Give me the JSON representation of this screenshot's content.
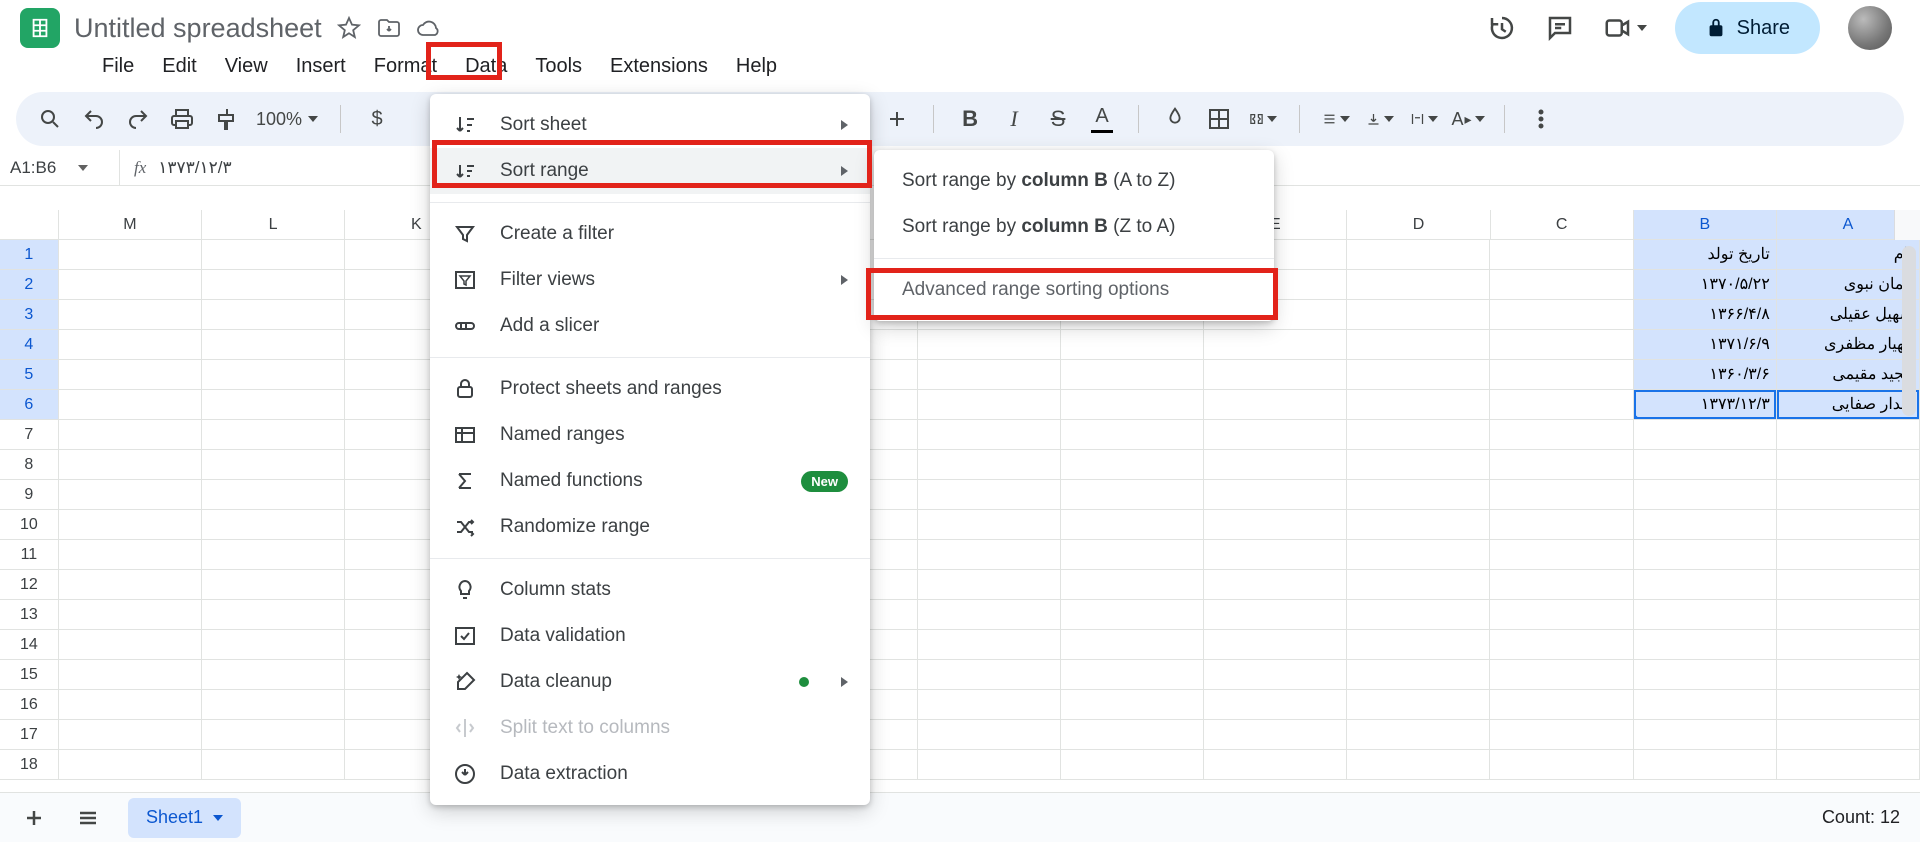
{
  "doc": {
    "title": "Untitled spreadsheet"
  },
  "menus": [
    "File",
    "Edit",
    "View",
    "Insert",
    "Format",
    "Data",
    "Tools",
    "Extensions",
    "Help"
  ],
  "share": "Share",
  "toolbar": {
    "zoom": "100%",
    "currency": "$"
  },
  "namebox": "A1:B6",
  "fx_value": "۱۳۷۳/۱۲/۳",
  "columns_visible": [
    "M",
    "L",
    "K",
    "",
    "",
    "",
    "",
    "",
    "E",
    "D",
    "C",
    "B",
    "A"
  ],
  "col_sel": [
    11,
    12
  ],
  "rows": 18,
  "row_sel": [
    1,
    2,
    3,
    4,
    5,
    6
  ],
  "cells": {
    "B": [
      "تاريخ تولد",
      "١٣٧٠/۵/٢٢",
      "١٣۶۶/۴/٨",
      "١٣٧١/۶/٩",
      "١٣۶٠/٣/۶",
      "١٣٧٣/١٢/٣"
    ],
    "A": [
      "نام",
      "ايمان نبوی",
      "سهيل عقيلی",
      "مهيار مظفری",
      "مجيد مقيمی",
      "بهدار صفايی"
    ]
  },
  "data_menu": {
    "sort_sheet": "Sort sheet",
    "sort_range": "Sort range",
    "create_filter": "Create a filter",
    "filter_views": "Filter views",
    "add_slicer": "Add a slicer",
    "protect": "Protect sheets and ranges",
    "named_ranges": "Named ranges",
    "named_functions": "Named functions",
    "named_functions_badge": "New",
    "randomize": "Randomize range",
    "column_stats": "Column stats",
    "data_validation": "Data validation",
    "data_cleanup": "Data cleanup",
    "split": "Split text to columns",
    "extraction": "Data extraction"
  },
  "sort_submenu": {
    "asc_pre": "Sort range by ",
    "asc_col": "column B",
    "asc_suf": " (A to Z)",
    "desc_pre": "Sort range by ",
    "desc_col": "column B",
    "desc_suf": " (Z to A)",
    "advanced": "Advanced range sorting options"
  },
  "sheet_tab": "Sheet1",
  "count_label": "Count: 12"
}
